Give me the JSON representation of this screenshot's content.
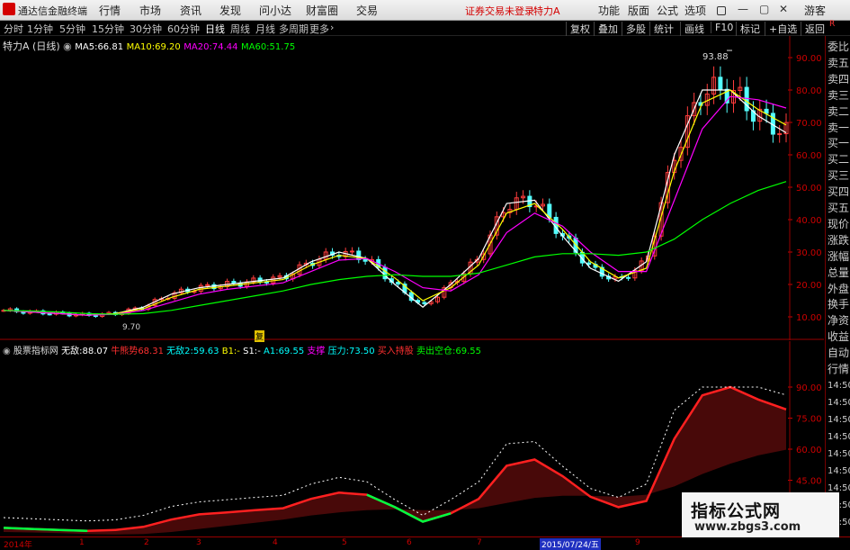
{
  "titlebar": {
    "app_name": "通达信金融终端",
    "menus": [
      "行情",
      "市场",
      "资讯",
      "发现",
      "问小达",
      "财富圈",
      "交易"
    ],
    "login_status": "证券交易未登录",
    "stock_title": "特力A",
    "right_menus": [
      "功能",
      "版面",
      "公式",
      "选项"
    ],
    "guest": "游客"
  },
  "toolbar": {
    "periods": [
      "分时",
      "1分钟",
      "5分钟",
      "15分钟",
      "30分钟",
      "60分钟",
      "日线",
      "周线",
      "月线",
      "多周期",
      "更多"
    ],
    "active_period": "日线",
    "right_tools": [
      "复权",
      "叠加",
      "多股",
      "统计",
      "画线",
      "F10",
      "标记",
      "+自选",
      "返回"
    ]
  },
  "main_chart": {
    "stock_label": "特力A",
    "period_tag": "(日线)",
    "ma": [
      {
        "label": "MA5:",
        "value": "66.81",
        "color": "#ffffff"
      },
      {
        "label": "MA10:",
        "value": "69.20",
        "color": "#ffff00"
      },
      {
        "label": "MA20:",
        "value": "74.44",
        "color": "#ff00ff"
      },
      {
        "label": "MA60:",
        "value": "51.75",
        "color": "#00ff00"
      }
    ],
    "high_marker": "93.88",
    "low_marker": "9.70",
    "event_marker": "复"
  },
  "sub_chart": {
    "indicator_name": "股票指标网",
    "items": [
      {
        "label": "无敌:",
        "value": "88.07",
        "color": "#ffffff"
      },
      {
        "label": "牛熊势",
        "value": "68.31",
        "color": "#ff3030"
      },
      {
        "label": "无敌2:",
        "value": "59.63",
        "color": "#00ffff"
      },
      {
        "label": "B1:",
        "value": "-",
        "color": "#ffff00"
      },
      {
        "label": "S1:",
        "value": "-",
        "color": "#ffffff"
      },
      {
        "label": "A1:",
        "value": "69.55",
        "color": "#00ffff"
      },
      {
        "label": "支撑",
        "value": "",
        "color": "#ff00ff"
      },
      {
        "label": "压力:",
        "value": "73.50",
        "color": "#00ffff"
      },
      {
        "label": "买入持股",
        "value": "",
        "color": "#ff3030"
      },
      {
        "label": "卖出空仓:",
        "value": "69.55",
        "color": "#00ff00"
      }
    ]
  },
  "main_axis": [
    "90.00",
    "80.00",
    "70.00",
    "60.00",
    "50.00",
    "40.00",
    "30.00",
    "20.00",
    "10.00"
  ],
  "sub_axis": [
    "90.00",
    "75.00",
    "60.00",
    "45.00",
    "30.00"
  ],
  "right_column": {
    "header": "R",
    "labels": [
      "委比",
      "卖五",
      "卖四",
      "卖三",
      "卖二",
      "卖一",
      "买一",
      "买二",
      "买三",
      "买四",
      "买五",
      "现价",
      "涨跌",
      "涨幅",
      "总量",
      "外盘",
      "换手",
      "净资",
      "收益"
    ],
    "sub_labels": [
      "自动",
      "行情"
    ],
    "times": [
      "14:50",
      "14:50",
      "14:50",
      "14:50",
      "14:50",
      "14:50",
      "14:50",
      "14:50",
      "14:50"
    ]
  },
  "x_axis": {
    "year_label": "2014年",
    "months": [
      "1",
      "2",
      "3",
      "4",
      "5",
      "6",
      "7",
      "8",
      "9"
    ],
    "cursor_date": "2015/07/24/五"
  },
  "watermark": {
    "title": "指标公式网",
    "url": "www.zbgs3.com"
  },
  "chart_data": {
    "type": "candlestick",
    "title": "特力A (日线)",
    "price_ylim": [
      5,
      100
    ],
    "price_axis_ticks": [
      10,
      20,
      30,
      40,
      50,
      60,
      70,
      80,
      90
    ],
    "series": [
      {
        "name": "MA5",
        "values": [
          12,
          11.5,
          11,
          10.5,
          11,
          13,
          17,
          19,
          20,
          21,
          22,
          27,
          30,
          28,
          20,
          13,
          20,
          28,
          45,
          46,
          35,
          25,
          21,
          27,
          60,
          80,
          80,
          72,
          66.81
        ]
      },
      {
        "name": "MA10",
        "values": [
          12,
          11.5,
          11,
          10.5,
          11,
          12.5,
          16,
          18.5,
          19.5,
          20.5,
          21.5,
          26,
          29,
          28,
          22,
          15,
          19,
          26,
          42,
          45,
          37,
          27,
          22,
          25,
          55,
          76,
          80,
          74,
          69.2
        ]
      },
      {
        "name": "MA20",
        "values": [
          12,
          11.5,
          11,
          10.5,
          10.8,
          12,
          14.5,
          17,
          18.5,
          19.5,
          20.5,
          24,
          27.5,
          28,
          24,
          19,
          18,
          23,
          36,
          42,
          38,
          30,
          24,
          24,
          46,
          68,
          78,
          77,
          74.44
        ]
      },
      {
        "name": "MA60",
        "values": [
          12,
          11.8,
          11.5,
          11,
          10.8,
          11,
          12,
          13.5,
          15,
          16.5,
          18,
          20,
          21.5,
          22.5,
          23,
          22.5,
          22.5,
          23.5,
          26,
          28.5,
          29.5,
          29.5,
          29,
          30,
          34,
          40,
          45,
          49,
          51.75
        ]
      }
    ],
    "annotations": {
      "high": 93.88,
      "low": 9.7
    },
    "grid": false
  }
}
